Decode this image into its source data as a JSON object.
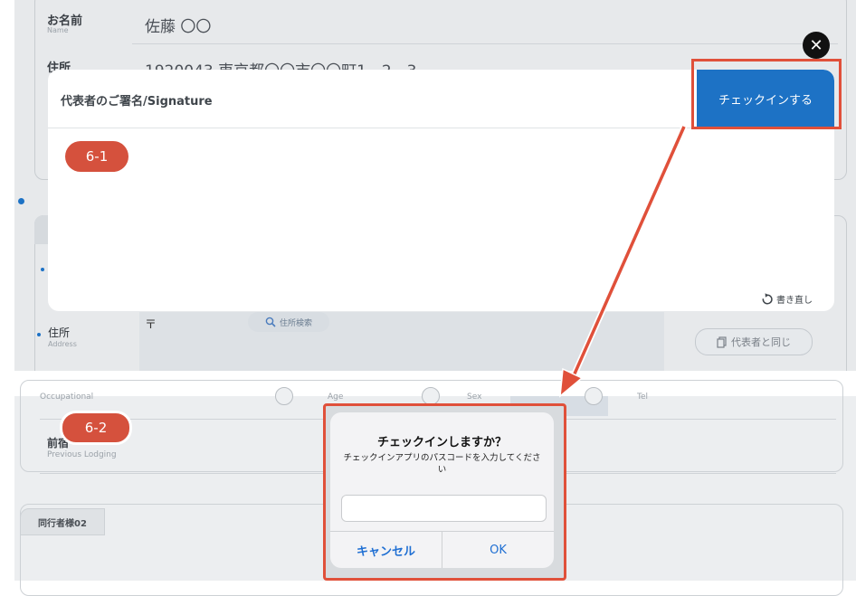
{
  "form": {
    "name": {
      "label": "お名前",
      "sub": "Name",
      "value": "佐藤 〇〇"
    },
    "address": {
      "label": "住所",
      "sub": "",
      "value": "1920043 東京都〇〇市〇〇町1 - 2 - 3"
    },
    "address2": {
      "label": "住所",
      "sub": "Address"
    },
    "postal_mark": "〒",
    "address_search": "住所検索",
    "same_as_rep": "代表者と同じ",
    "occupation_sub": "Occupational",
    "age_sub": "Age",
    "sex_sub": "Sex",
    "tel_sub": "Tel",
    "prev_lodging": {
      "label": "前宿",
      "sub": "Previous Lodging"
    },
    "companion_tab": "同行者様02"
  },
  "modal": {
    "title": "代表者のご署名/Signature",
    "checkin_button": "チェックインする",
    "rewrite": "書き直し",
    "close_glyph": "✕"
  },
  "badges": {
    "b1": "6-1",
    "b2": "6-2"
  },
  "dialog": {
    "title": "チェックインしますか？",
    "message": "チェックインアプリのパスコードを入力してください",
    "input_value": "",
    "cancel": "キャンセル",
    "ok": "OK"
  },
  "colors": {
    "accent": "#1d72c5",
    "annotation": "#e0503a"
  }
}
